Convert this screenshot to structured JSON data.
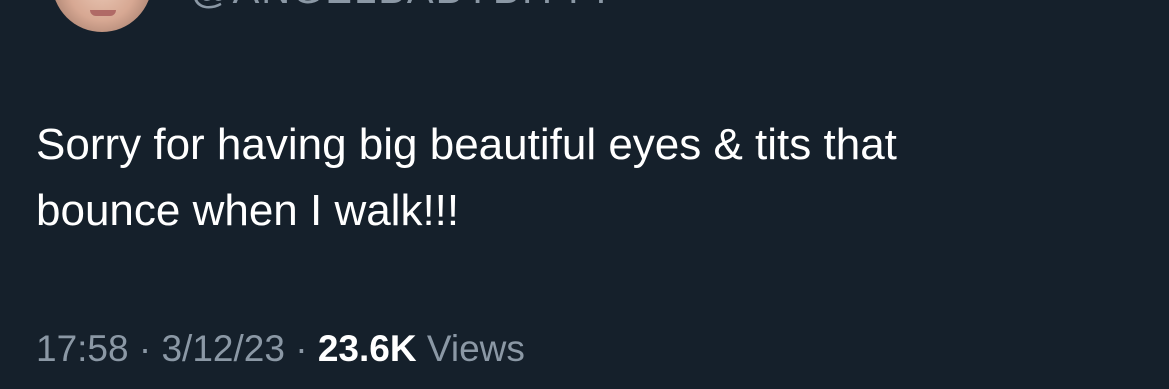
{
  "author": {
    "handle": "@ANGELBABYBITTY"
  },
  "tweet": {
    "text": "Sorry for having big beautiful eyes & tits that\nbounce when I walk!!!",
    "time": "17:58",
    "separator1": " · ",
    "date": "3/12/23",
    "separator2": " · ",
    "views_count": "23.6K",
    "views_label": " Views"
  },
  "colors": {
    "background": "#15202b",
    "text": "#ffffff",
    "muted": "#8b98a5"
  }
}
